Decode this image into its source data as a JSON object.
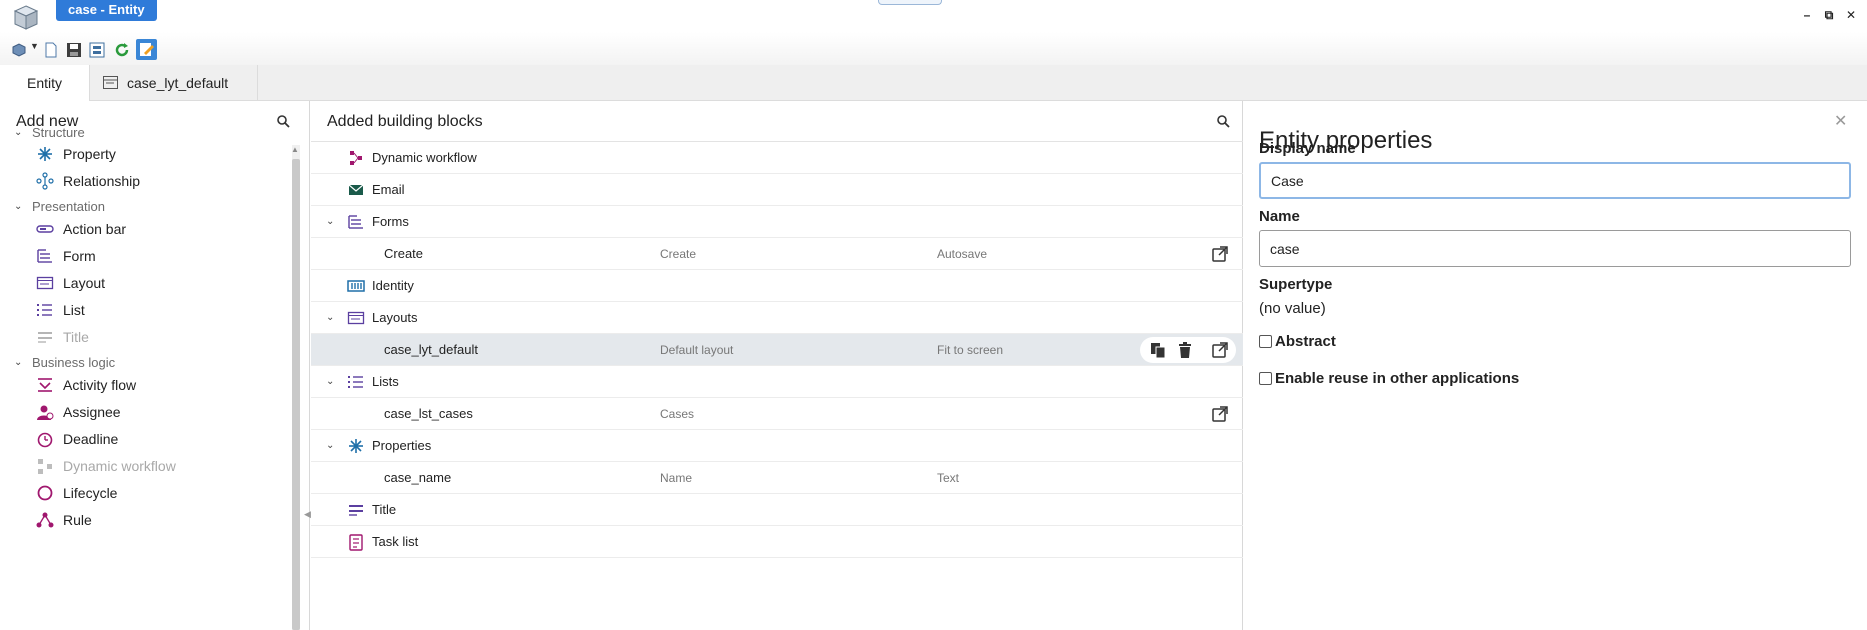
{
  "window": {
    "title": "case - Entity"
  },
  "toolbar": {
    "icons": [
      "network-icon",
      "dropdown-arrow-icon",
      "new-document-icon",
      "save-icon",
      "save-all-icon",
      "refresh-icon",
      "edit-icon"
    ]
  },
  "tabs": [
    {
      "label": "Entity",
      "active": true
    },
    {
      "label": "case_lyt_default",
      "active": false
    }
  ],
  "left": {
    "title": "Add new",
    "groups": [
      {
        "label": "Structure",
        "items": [
          {
            "label": "Property"
          },
          {
            "label": "Relationship"
          }
        ]
      },
      {
        "label": "Presentation",
        "items": [
          {
            "label": "Action bar"
          },
          {
            "label": "Form"
          },
          {
            "label": "Layout"
          },
          {
            "label": "List"
          },
          {
            "label": "Title"
          }
        ]
      },
      {
        "label": "Business logic",
        "items": [
          {
            "label": "Activity flow"
          },
          {
            "label": "Assignee"
          },
          {
            "label": "Deadline"
          },
          {
            "label": "Dynamic workflow"
          },
          {
            "label": "Lifecycle"
          },
          {
            "label": "Rule"
          }
        ]
      }
    ]
  },
  "middle": {
    "title": "Added building blocks",
    "rows": [
      {
        "label": "Dynamic workflow"
      },
      {
        "label": "Email"
      },
      {
        "label": "Forms"
      },
      {
        "label": "Create",
        "c2": "Create",
        "c3": "Autosave"
      },
      {
        "label": "Identity"
      },
      {
        "label": "Layouts"
      },
      {
        "label": "case_lyt_default",
        "c2": "Default layout",
        "c3": "Fit to screen"
      },
      {
        "label": "Lists"
      },
      {
        "label": "case_lst_cases",
        "c2": "Cases",
        "c3": ""
      },
      {
        "label": "Properties"
      },
      {
        "label": "case_name",
        "c2": "Name",
        "c3": "Text"
      },
      {
        "label": "Title"
      },
      {
        "label": "Task list"
      }
    ]
  },
  "right": {
    "title": "Entity properties",
    "display_name_label": "Display name",
    "display_name_value": "Case",
    "name_label": "Name",
    "name_value": "case",
    "supertype_label": "Supertype",
    "supertype_value": "(no value)",
    "abstract_label": "Abstract",
    "abstract_checked": false,
    "reuse_label": "Enable reuse in other applications",
    "reuse_checked": false
  },
  "colors": {
    "accent": "#2f7bd9",
    "selection": "#e4e8ec",
    "purple_icon": "#5b3fa0",
    "magenta_icon": "#a0176e"
  }
}
